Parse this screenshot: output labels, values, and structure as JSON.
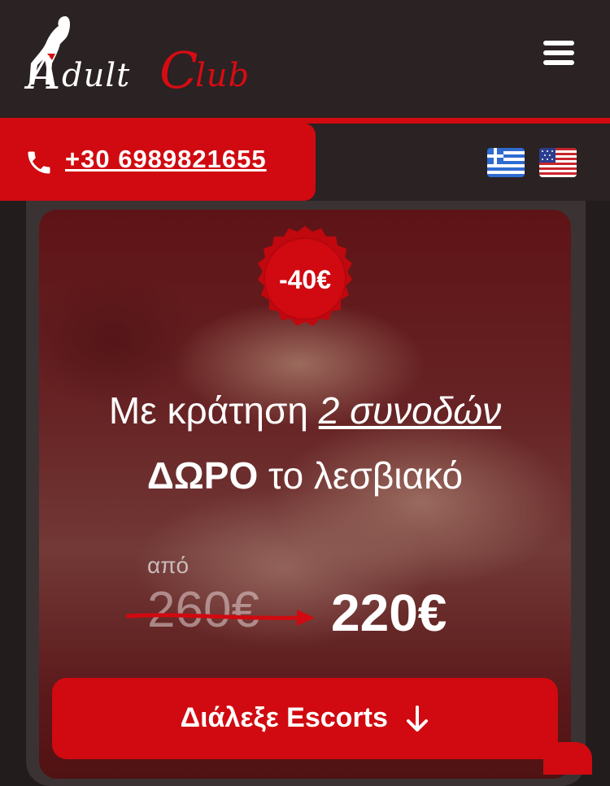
{
  "header": {
    "logo": {
      "first_letter": "A",
      "first_word_rest": "dult",
      "second_letter": "C",
      "second_word_rest": "lub",
      "figure_icon": "silhouette-figure-icon"
    },
    "menu_icon": "hamburger-menu-icon"
  },
  "contact": {
    "phone_icon": "phone-icon",
    "phone_number": "+30 6989821655"
  },
  "languages": [
    {
      "flag_icon": "greek-flag-icon",
      "code": "el"
    },
    {
      "flag_icon": "us-flag-icon",
      "code": "en"
    }
  ],
  "promo": {
    "badge": "-40€",
    "line1_prefix": "Με κράτηση ",
    "line1_highlight": "2 συνοδών",
    "line2_bold": "ΔΩΡΟ",
    "line2_rest": " το λεσβιακό",
    "from_label": "από",
    "old_price": "260€",
    "new_price": "220€"
  },
  "cta": {
    "label": "Διάλεξε Escorts",
    "icon": "arrow-down-icon"
  },
  "colors": {
    "brand_red": "#d00a10",
    "header_bg": "#2a2223",
    "page_bg": "#221c1d"
  }
}
